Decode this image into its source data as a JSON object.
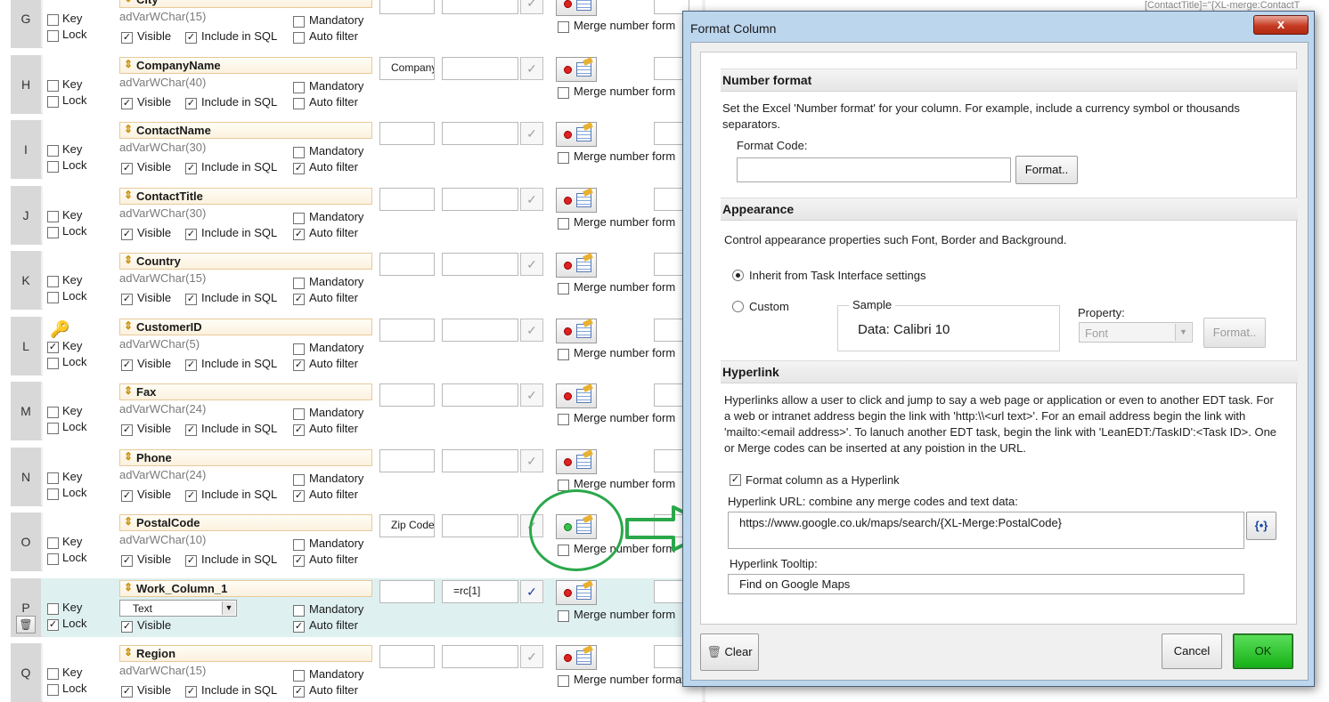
{
  "background_grid": {
    "merge_label": "Merge number form",
    "merge_label_last": "Merge number format",
    "key_label": "Key",
    "lock_label": "Lock",
    "mandatory_label": "Mandatory",
    "auto_filter_label": "Auto filter",
    "visible_label": "Visible",
    "include_sql_label": "Include in SQL",
    "corner_text": "[ContactTitle]=\"{XL-merge:ContactT",
    "rows": [
      {
        "letter": "G",
        "field": "City",
        "type": "adVarWChar(15)",
        "key": false,
        "lock": false,
        "visible": true,
        "include_sql": true,
        "mandatory": false,
        "auto_filter": false,
        "header_text": "",
        "formula": "",
        "green": false
      },
      {
        "letter": "H",
        "field": "CompanyName",
        "type": "adVarWChar(40)",
        "key": false,
        "lock": false,
        "visible": true,
        "include_sql": true,
        "mandatory": false,
        "auto_filter": false,
        "header_text": "Company",
        "formula": "",
        "green": false
      },
      {
        "letter": "I",
        "field": "ContactName",
        "type": "adVarWChar(30)",
        "key": false,
        "lock": false,
        "visible": true,
        "include_sql": true,
        "mandatory": false,
        "auto_filter": true,
        "header_text": "",
        "formula": "",
        "green": false
      },
      {
        "letter": "J",
        "field": "ContactTitle",
        "type": "adVarWChar(30)",
        "key": false,
        "lock": false,
        "visible": true,
        "include_sql": true,
        "mandatory": false,
        "auto_filter": true,
        "header_text": "",
        "formula": "",
        "green": false
      },
      {
        "letter": "K",
        "field": "Country",
        "type": "adVarWChar(15)",
        "key": false,
        "lock": false,
        "visible": true,
        "include_sql": true,
        "mandatory": false,
        "auto_filter": true,
        "header_text": "",
        "formula": "",
        "green": false
      },
      {
        "letter": "L",
        "field": "CustomerID",
        "type": "adVarWChar(5)",
        "key": true,
        "lock": false,
        "visible": true,
        "include_sql": true,
        "mandatory": false,
        "auto_filter": true,
        "header_text": "",
        "formula": "",
        "green": false
      },
      {
        "letter": "M",
        "field": "Fax",
        "type": "adVarWChar(24)",
        "key": false,
        "lock": false,
        "visible": true,
        "include_sql": true,
        "mandatory": false,
        "auto_filter": true,
        "header_text": "",
        "formula": "",
        "green": false
      },
      {
        "letter": "N",
        "field": "Phone",
        "type": "adVarWChar(24)",
        "key": false,
        "lock": false,
        "visible": true,
        "include_sql": true,
        "mandatory": false,
        "auto_filter": true,
        "header_text": "",
        "formula": "",
        "green": false
      },
      {
        "letter": "O",
        "field": "PostalCode",
        "type": "adVarWChar(10)",
        "key": false,
        "lock": false,
        "visible": true,
        "include_sql": true,
        "mandatory": false,
        "auto_filter": true,
        "header_text": "Zip Code",
        "formula": "",
        "green": true
      },
      {
        "letter": "P",
        "field": "Work_Column_1",
        "type": "",
        "select_value": "Text",
        "key": false,
        "lock": true,
        "visible": true,
        "include_sql": null,
        "mandatory": false,
        "auto_filter": true,
        "header_text": "",
        "formula": "=rc[1]",
        "green": false,
        "work": true
      },
      {
        "letter": "Q",
        "field": "Region",
        "type": "adVarWChar(15)",
        "key": false,
        "lock": false,
        "visible": true,
        "include_sql": true,
        "mandatory": false,
        "auto_filter": true,
        "header_text": "",
        "formula": "",
        "green": false
      }
    ]
  },
  "dialog": {
    "title": "Format Column",
    "close_label": "x",
    "number_format": {
      "header": "Number format",
      "description": "Set the Excel 'Number format' for your column.    For example, include a currency symbol or thousands separators.",
      "format_code_label": "Format Code:",
      "format_code_value": "",
      "format_button": "Format.."
    },
    "appearance": {
      "header": "Appearance",
      "description": "Control appearance properties such Font, Border and Background.",
      "inherit_label": "Inherit from Task Interface settings",
      "custom_label": "Custom",
      "selected": "inherit",
      "sample_title": "Sample",
      "sample_text": "Data: Calibri 10",
      "property_label": "Property:",
      "property_value": "Font",
      "format_button": "Format.."
    },
    "hyperlink": {
      "header": "Hyperlink",
      "description": "Hyperlinks allow a user to click and jump to say a web page or application or even to another EDT task. For a web or intranet address begin the link with 'http:\\\\<url text>'.  For an email address begin the link with 'mailto:<email address>'.  To lanuch another EDT task, begin the link with 'LeanEDT:/TaskID':<Task ID>.  One or Merge codes can be inserted at any poistion in the URL.",
      "checkbox_label": "Format column as a Hyperlink",
      "checked": true,
      "url_label": "Hyperlink URL: combine any merge codes and text data:",
      "url_value": "https://www.google.co.uk/maps/search/{XL-Merge:PostalCode}",
      "merge_button": "{•}",
      "tooltip_label": "Hyperlink Tooltip:",
      "tooltip_value": "Find on Google Maps"
    },
    "footer": {
      "clear_label": "Clear",
      "cancel_label": "Cancel",
      "ok_label": "OK"
    }
  },
  "colors": {
    "annotation": "#2aa84a",
    "ok_button": "#14b014",
    "dialog_frame": "#bcd6ee"
  }
}
